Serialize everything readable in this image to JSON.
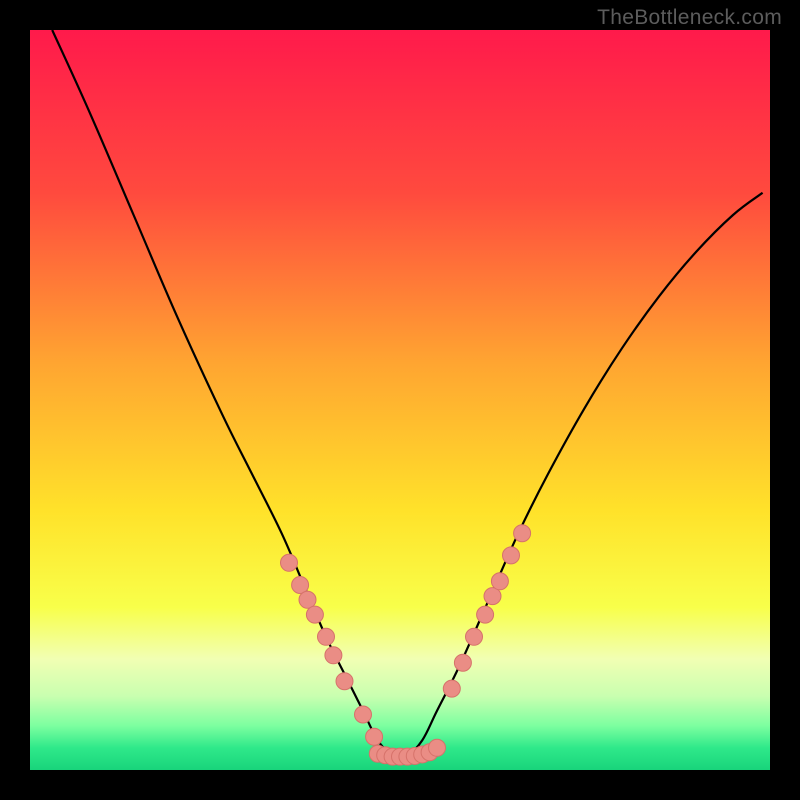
{
  "watermark": "TheBottleneck.com",
  "chart_data": {
    "type": "line",
    "title": "",
    "xlabel": "",
    "ylabel": "",
    "xlim": [
      0,
      100
    ],
    "ylim": [
      0,
      100
    ],
    "series": [
      {
        "name": "curve",
        "x": [
          3,
          8,
          14,
          20,
          26,
          30,
          34,
          37,
          40,
          43,
          45,
          47,
          49,
          51,
          53,
          55,
          58,
          62,
          66,
          70,
          75,
          80,
          85,
          90,
          95,
          99
        ],
        "y": [
          100,
          89,
          75,
          61,
          48,
          40,
          32,
          25,
          18,
          12,
          8,
          4,
          2,
          2,
          4,
          8,
          14,
          23,
          32,
          40,
          49,
          57,
          64,
          70,
          75,
          78
        ]
      },
      {
        "name": "dots-left",
        "x": [
          35,
          36.5,
          37.5,
          38.5,
          40,
          41,
          42.5,
          45,
          46.5
        ],
        "y": [
          28,
          25,
          23,
          21,
          18,
          15.5,
          12,
          7.5,
          4.5
        ]
      },
      {
        "name": "dots-bottom",
        "x": [
          47,
          48,
          49,
          50,
          51,
          52,
          53,
          54,
          55
        ],
        "y": [
          2.2,
          2.0,
          1.8,
          1.8,
          1.8,
          1.9,
          2.1,
          2.4,
          3.0
        ]
      },
      {
        "name": "dots-right",
        "x": [
          57,
          58.5,
          60,
          61.5,
          62.5,
          63.5,
          65,
          66.5
        ],
        "y": [
          11,
          14.5,
          18,
          21,
          23.5,
          25.5,
          29,
          32
        ]
      }
    ],
    "background_gradient": {
      "stops": [
        {
          "pct": 0,
          "color": "#ff1a4b"
        },
        {
          "pct": 22,
          "color": "#ff4a3e"
        },
        {
          "pct": 45,
          "color": "#ffa531"
        },
        {
          "pct": 65,
          "color": "#ffe22a"
        },
        {
          "pct": 78,
          "color": "#f8ff4a"
        },
        {
          "pct": 85,
          "color": "#f1ffb3"
        },
        {
          "pct": 90,
          "color": "#c9ffb0"
        },
        {
          "pct": 94,
          "color": "#7dffa0"
        },
        {
          "pct": 97,
          "color": "#2fe98a"
        },
        {
          "pct": 100,
          "color": "#19d47b"
        }
      ]
    },
    "colors": {
      "curve": "#000000",
      "dot_fill": "#ea8d85",
      "dot_stroke": "#d6726a"
    }
  }
}
